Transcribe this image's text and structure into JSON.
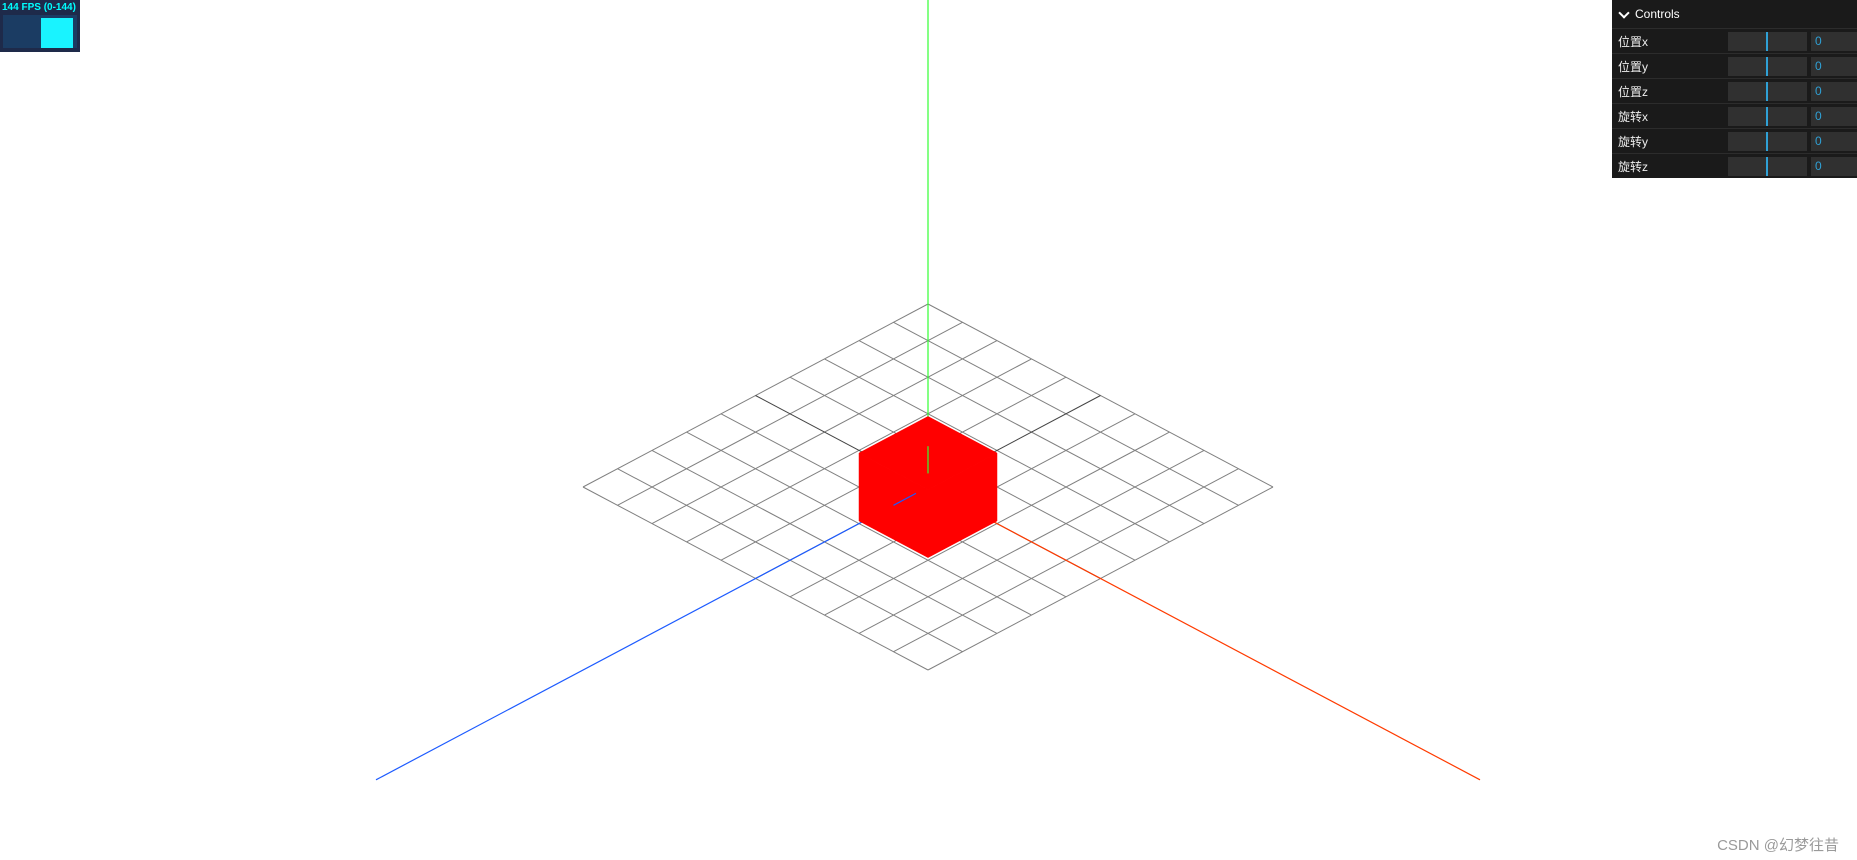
{
  "stats": {
    "fps_text": "144 FPS (0-144)",
    "bar_fill": 0.9
  },
  "gui": {
    "title": "Controls",
    "controls": [
      {
        "label": "位置x",
        "value": "0",
        "min": -5,
        "max": 5,
        "current": 0
      },
      {
        "label": "位置y",
        "value": "0",
        "min": -5,
        "max": 5,
        "current": 0
      },
      {
        "label": "位置z",
        "value": "0",
        "min": -5,
        "max": 5,
        "current": 0
      },
      {
        "label": "旋转x",
        "value": "0",
        "min": -5,
        "max": 5,
        "current": 0
      },
      {
        "label": "旋转y",
        "value": "0",
        "min": -5,
        "max": 5,
        "current": 0
      },
      {
        "label": "旋转z",
        "value": "0",
        "min": -5,
        "max": 5,
        "current": 0
      }
    ]
  },
  "scene": {
    "grid_divisions": 10,
    "colors": {
      "background": "#ffffff",
      "grid": "#808080",
      "x_axis": "#ff3b00",
      "y_axis": "#33ff33",
      "z_axis": "#1d5bff",
      "cube": "#ff0000",
      "stats_text": "#00ffff",
      "stats_bar": "#19f3ff",
      "gui_accent": "#2fa1d6"
    }
  },
  "watermark": "CSDN @幻梦往昔"
}
